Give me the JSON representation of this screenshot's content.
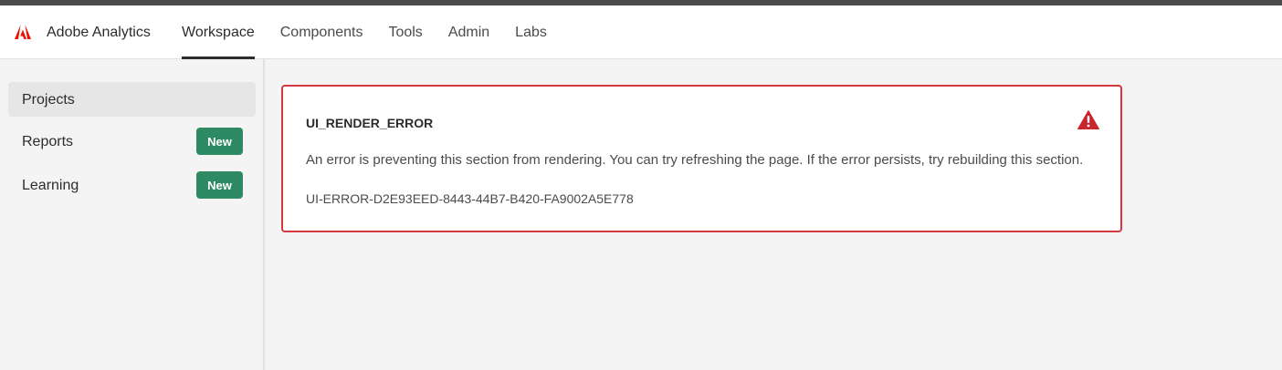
{
  "header": {
    "app_name": "Adobe Analytics",
    "logo_icon": "adobe-logo-icon",
    "tabs": [
      {
        "label": "Workspace",
        "active": true
      },
      {
        "label": "Components",
        "active": false
      },
      {
        "label": "Tools",
        "active": false
      },
      {
        "label": "Admin",
        "active": false
      },
      {
        "label": "Labs",
        "active": false
      }
    ]
  },
  "sidebar": {
    "items": [
      {
        "label": "Projects",
        "selected": true
      },
      {
        "label": "Reports",
        "badge": "New"
      },
      {
        "label": "Learning",
        "badge": "New"
      }
    ]
  },
  "error": {
    "title": "UI_RENDER_ERROR",
    "icon": "alert-triangle-icon",
    "message": "An error is preventing this section from rendering. You can try refreshing the page. If the error persists, try rebuilding this section.",
    "code": "UI-ERROR-D2E93EED-8443-44B7-B420-FA9002A5E778"
  },
  "colors": {
    "accent_red": "#d7373f",
    "badge_green": "#2d8a63",
    "adobe_red": "#eb1000"
  }
}
